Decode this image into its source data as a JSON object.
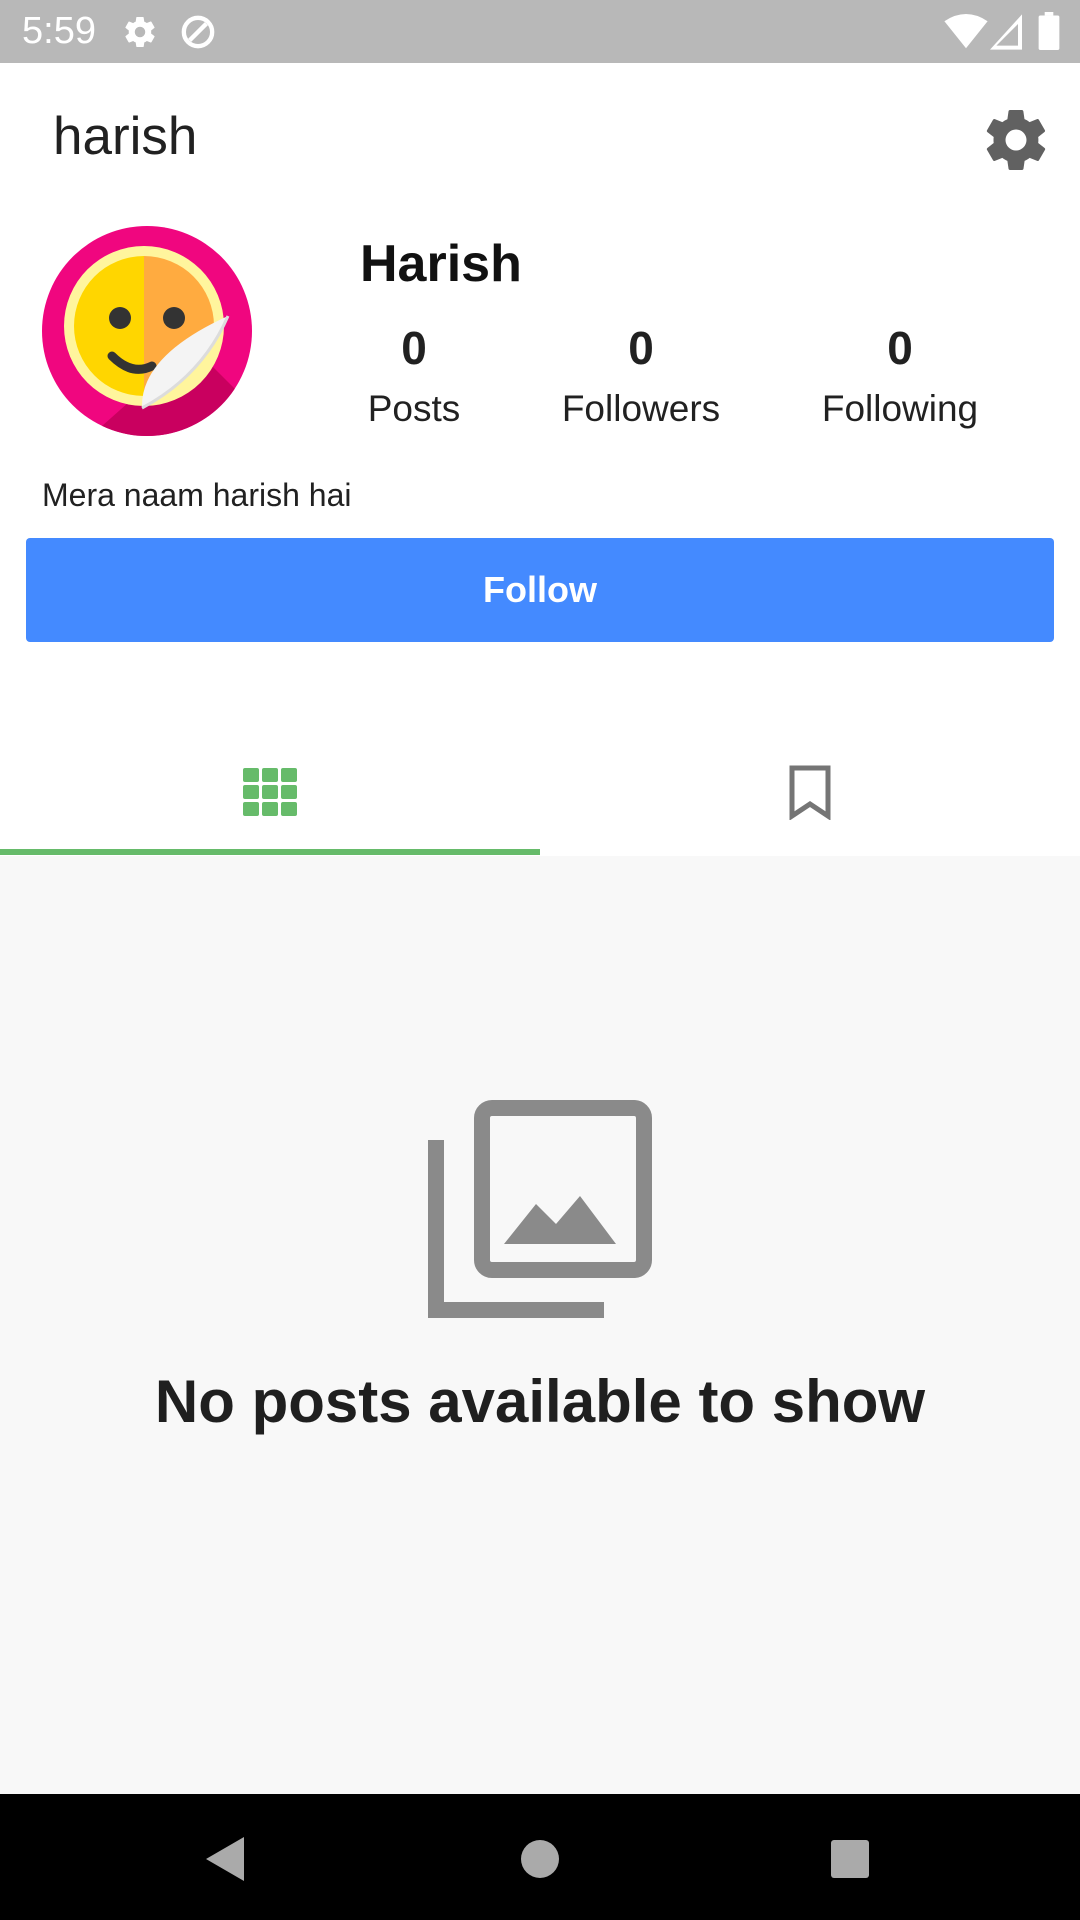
{
  "status_bar": {
    "time": "5:59",
    "icons": [
      "settings-icon",
      "data-saver-icon",
      "wifi-icon",
      "signal-icon",
      "battery-icon"
    ]
  },
  "app_bar": {
    "title": "harish",
    "settings_icon": "gear-icon"
  },
  "profile": {
    "display_name": "Harish",
    "avatar_icon": "smiley-sticker-avatar",
    "bio": "Mera naam harish hai",
    "stats": [
      {
        "count": "0",
        "label": "Posts"
      },
      {
        "count": "0",
        "label": "Followers"
      },
      {
        "count": "0",
        "label": "Following"
      }
    ],
    "follow_label": "Follow"
  },
  "tabs": [
    {
      "icon": "grid-icon",
      "selected": true
    },
    {
      "icon": "bookmark-icon",
      "selected": false
    }
  ],
  "empty_state": {
    "icon": "photo-library-icon",
    "message": "No posts available to show"
  },
  "nav_bar": {
    "buttons": [
      "back-icon",
      "home-icon",
      "recents-icon"
    ]
  },
  "colors": {
    "accent": "#448aff",
    "tab_indicator": "#66bb6a",
    "grid_icon": "#66bb6a",
    "status_bar": "#b8b8b8"
  }
}
